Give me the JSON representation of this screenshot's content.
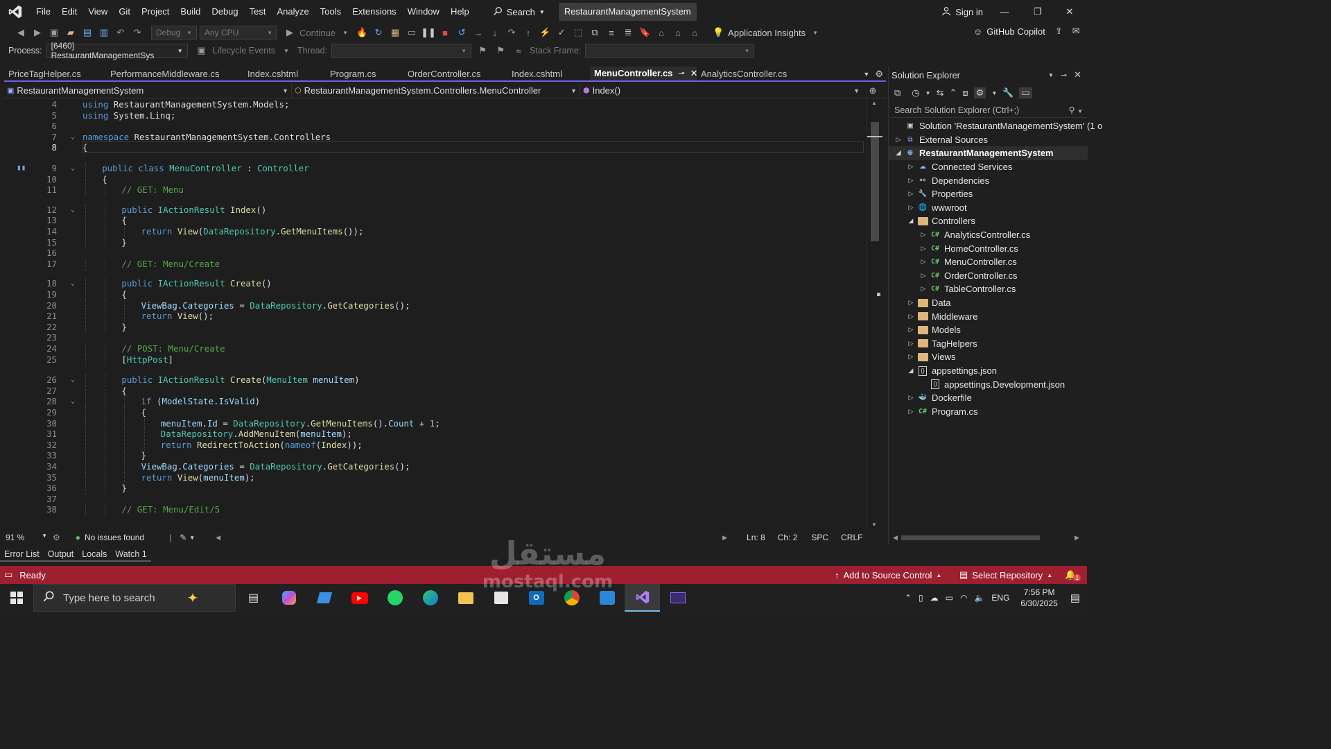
{
  "menu": {
    "items": [
      "File",
      "Edit",
      "View",
      "Git",
      "Project",
      "Build",
      "Debug",
      "Test",
      "Analyze",
      "Tools",
      "Extensions",
      "Window",
      "Help"
    ],
    "search_label": "Search",
    "solution_title": "RestaurantManagementSystem",
    "signin_label": "Sign in"
  },
  "toolbar": {
    "config": "Debug",
    "platform": "Any CPU",
    "continue_label": "Continue",
    "app_insights_label": "Application Insights",
    "copilot_label": "GitHub Copilot",
    "process_label": "Process:",
    "process_value": "[6460] RestaurantManagementSys",
    "lifecycle_label": "Lifecycle Events",
    "thread_label": "Thread:",
    "stack_frame_label": "Stack Frame:"
  },
  "tabs": [
    {
      "label": "PriceTagHelper.cs",
      "active": false
    },
    {
      "label": "PerformanceMiddleware.cs",
      "active": false
    },
    {
      "label": "Index.cshtml",
      "active": false
    },
    {
      "label": "Program.cs",
      "active": false
    },
    {
      "label": "OrderController.cs",
      "active": false
    },
    {
      "label": "Index.cshtml",
      "active": false
    },
    {
      "label": "MenuController.cs",
      "active": true
    },
    {
      "label": "AnalyticsController.cs",
      "active": false
    }
  ],
  "navbar": {
    "project": "RestaurantManagementSystem",
    "type": "RestaurantManagementSystem.Controllers.MenuController",
    "member": "Index()"
  },
  "editor": {
    "current_line": 8,
    "lines": [
      {
        "n": 4,
        "indent": 0,
        "tokens": [
          [
            "kw",
            "using"
          ],
          [
            "pl",
            " RestaurantManagementSystem.Models;"
          ]
        ]
      },
      {
        "n": 5,
        "indent": 0,
        "tokens": [
          [
            "kw",
            "using"
          ],
          [
            "pl",
            " System.Linq;"
          ]
        ]
      },
      {
        "n": 6,
        "indent": 0,
        "tokens": []
      },
      {
        "n": 7,
        "indent": 0,
        "fold": true,
        "tokens": [
          [
            "kw",
            "namespace"
          ],
          [
            "pl",
            " RestaurantManagementSystem.Controllers"
          ]
        ]
      },
      {
        "n": 8,
        "indent": 0,
        "tokens": [
          [
            "pl",
            "{"
          ]
        ]
      },
      {
        "n": 9,
        "indent": 1,
        "fold": true,
        "tokens": [
          [
            "kw",
            "public class "
          ],
          [
            "ty",
            "MenuController"
          ],
          [
            "pl",
            " : "
          ],
          [
            "ty",
            "Controller"
          ]
        ]
      },
      {
        "n": 10,
        "indent": 1,
        "tokens": [
          [
            "pl",
            "{"
          ]
        ]
      },
      {
        "n": 11,
        "indent": 2,
        "tokens": [
          [
            "cm",
            "// GET: Menu"
          ]
        ]
      },
      {
        "n": 12,
        "indent": 2,
        "fold": true,
        "tokens": [
          [
            "kw",
            "public "
          ],
          [
            "ty",
            "IActionResult"
          ],
          [
            "mt",
            " Index"
          ],
          [
            "pl",
            "()"
          ]
        ]
      },
      {
        "n": 13,
        "indent": 2,
        "tokens": [
          [
            "pl",
            "{"
          ]
        ]
      },
      {
        "n": 14,
        "indent": 3,
        "tokens": [
          [
            "kw",
            "return "
          ],
          [
            "mt",
            "View"
          ],
          [
            "pl",
            "("
          ],
          [
            "ty",
            "DataRepository"
          ],
          [
            "pl",
            "."
          ],
          [
            "mt",
            "GetMenuItems"
          ],
          [
            "pl",
            "());"
          ]
        ]
      },
      {
        "n": 15,
        "indent": 2,
        "tokens": [
          [
            "pl",
            "}"
          ]
        ]
      },
      {
        "n": 16,
        "indent": 0,
        "tokens": []
      },
      {
        "n": 17,
        "indent": 2,
        "tokens": [
          [
            "cm",
            "// GET: Menu/Create"
          ]
        ]
      },
      {
        "n": 18,
        "indent": 2,
        "fold": true,
        "tokens": [
          [
            "kw",
            "public "
          ],
          [
            "ty",
            "IActionResult"
          ],
          [
            "mt",
            " Create"
          ],
          [
            "pl",
            "()"
          ]
        ]
      },
      {
        "n": 19,
        "indent": 2,
        "tokens": [
          [
            "pl",
            "{"
          ]
        ]
      },
      {
        "n": 20,
        "indent": 3,
        "tokens": [
          [
            "vr",
            "ViewBag"
          ],
          [
            "pl",
            "."
          ],
          [
            "vr",
            "Categories"
          ],
          [
            "pl",
            " = "
          ],
          [
            "ty",
            "DataRepository"
          ],
          [
            "pl",
            "."
          ],
          [
            "mt",
            "GetCategories"
          ],
          [
            "pl",
            "();"
          ]
        ]
      },
      {
        "n": 21,
        "indent": 3,
        "tokens": [
          [
            "kw",
            "return "
          ],
          [
            "mt",
            "View"
          ],
          [
            "pl",
            "();"
          ]
        ]
      },
      {
        "n": 22,
        "indent": 2,
        "tokens": [
          [
            "pl",
            "}"
          ]
        ]
      },
      {
        "n": 23,
        "indent": 0,
        "tokens": []
      },
      {
        "n": 24,
        "indent": 2,
        "tokens": [
          [
            "cm",
            "// POST: Menu/Create"
          ]
        ]
      },
      {
        "n": 25,
        "indent": 2,
        "tokens": [
          [
            "pl",
            "["
          ],
          [
            "ty",
            "HttpPost"
          ],
          [
            "pl",
            "]"
          ]
        ]
      },
      {
        "n": 26,
        "indent": 2,
        "fold": true,
        "tokens": [
          [
            "kw",
            "public "
          ],
          [
            "ty",
            "IActionResult"
          ],
          [
            "mt",
            " Create"
          ],
          [
            "pl",
            "("
          ],
          [
            "ty",
            "MenuItem"
          ],
          [
            "vr",
            " menuItem"
          ],
          [
            "pl",
            ")"
          ]
        ]
      },
      {
        "n": 27,
        "indent": 2,
        "tokens": [
          [
            "pl",
            "{"
          ]
        ]
      },
      {
        "n": 28,
        "indent": 3,
        "fold": true,
        "tokens": [
          [
            "kw",
            "if "
          ],
          [
            "pl",
            "("
          ],
          [
            "vr",
            "ModelState"
          ],
          [
            "pl",
            "."
          ],
          [
            "vr",
            "IsValid"
          ],
          [
            "pl",
            ")"
          ]
        ]
      },
      {
        "n": 29,
        "indent": 3,
        "tokens": [
          [
            "pl",
            "{"
          ]
        ]
      },
      {
        "n": 30,
        "indent": 4,
        "tokens": [
          [
            "vr",
            "menuItem"
          ],
          [
            "pl",
            "."
          ],
          [
            "vr",
            "Id"
          ],
          [
            "pl",
            " = "
          ],
          [
            "ty",
            "DataRepository"
          ],
          [
            "pl",
            "."
          ],
          [
            "mt",
            "GetMenuItems"
          ],
          [
            "pl",
            "()."
          ],
          [
            "vr",
            "Count"
          ],
          [
            "pl",
            " + "
          ],
          [
            "nu",
            "1"
          ],
          [
            "pl",
            ";"
          ]
        ]
      },
      {
        "n": 31,
        "indent": 4,
        "tokens": [
          [
            "ty",
            "DataRepository"
          ],
          [
            "pl",
            "."
          ],
          [
            "mt",
            "AddMenuItem"
          ],
          [
            "pl",
            "("
          ],
          [
            "vr",
            "menuItem"
          ],
          [
            "pl",
            ");"
          ]
        ]
      },
      {
        "n": 32,
        "indent": 4,
        "tokens": [
          [
            "kw",
            "return "
          ],
          [
            "mt",
            "RedirectToAction"
          ],
          [
            "pl",
            "("
          ],
          [
            "kw",
            "nameof"
          ],
          [
            "pl",
            "("
          ],
          [
            "mt",
            "Index"
          ],
          [
            "pl",
            "));"
          ]
        ]
      },
      {
        "n": 33,
        "indent": 3,
        "tokens": [
          [
            "pl",
            "}"
          ]
        ]
      },
      {
        "n": 34,
        "indent": 3,
        "tokens": [
          [
            "vr",
            "ViewBag"
          ],
          [
            "pl",
            "."
          ],
          [
            "vr",
            "Categories"
          ],
          [
            "pl",
            " = "
          ],
          [
            "ty",
            "DataRepository"
          ],
          [
            "pl",
            "."
          ],
          [
            "mt",
            "GetCategories"
          ],
          [
            "pl",
            "();"
          ]
        ]
      },
      {
        "n": 35,
        "indent": 3,
        "tokens": [
          [
            "kw",
            "return "
          ],
          [
            "mt",
            "View"
          ],
          [
            "pl",
            "("
          ],
          [
            "vr",
            "menuItem"
          ],
          [
            "pl",
            ");"
          ]
        ]
      },
      {
        "n": 36,
        "indent": 2,
        "tokens": [
          [
            "pl",
            "}"
          ]
        ]
      },
      {
        "n": 37,
        "indent": 0,
        "tokens": []
      },
      {
        "n": 38,
        "indent": 2,
        "tokens": [
          [
            "cm",
            "// GET: Menu/Edit/5"
          ]
        ]
      }
    ]
  },
  "editor_status": {
    "zoom": "91 %",
    "issues": "No issues found",
    "line": "Ln: 8",
    "col": "Ch: 2",
    "whitespace": "SPC",
    "eol": "CRLF"
  },
  "tool_tabs": [
    "Error List",
    "Output",
    "Locals",
    "Watch 1"
  ],
  "solution_explorer": {
    "title": "Solution Explorer",
    "search_placeholder": "Search Solution Explorer (Ctrl+;)",
    "tree": [
      {
        "label": "Solution 'RestaurantManagementSystem' (1 o",
        "depth": 0,
        "arrow": "",
        "icon": "solution"
      },
      {
        "label": "External Sources",
        "depth": 0,
        "arrow": "collapsed",
        "icon": "external"
      },
      {
        "label": "RestaurantManagementSystem",
        "depth": 0,
        "arrow": "expanded",
        "icon": "project",
        "selected": true
      },
      {
        "label": "Connected Services",
        "depth": 1,
        "arrow": "collapsed",
        "icon": "connected"
      },
      {
        "label": "Dependencies",
        "depth": 1,
        "arrow": "collapsed",
        "icon": "deps"
      },
      {
        "label": "Properties",
        "depth": 1,
        "arrow": "collapsed",
        "icon": "props"
      },
      {
        "label": "wwwroot",
        "depth": 1,
        "arrow": "collapsed",
        "icon": "globe"
      },
      {
        "label": "Controllers",
        "depth": 1,
        "arrow": "expanded",
        "icon": "folder"
      },
      {
        "label": "AnalyticsController.cs",
        "depth": 2,
        "arrow": "collapsed",
        "icon": "cs"
      },
      {
        "label": "HomeController.cs",
        "depth": 2,
        "arrow": "collapsed",
        "icon": "cs"
      },
      {
        "label": "MenuController.cs",
        "depth": 2,
        "arrow": "collapsed",
        "icon": "cs"
      },
      {
        "label": "OrderController.cs",
        "depth": 2,
        "arrow": "collapsed",
        "icon": "cs"
      },
      {
        "label": "TableController.cs",
        "depth": 2,
        "arrow": "collapsed",
        "icon": "cs"
      },
      {
        "label": "Data",
        "depth": 1,
        "arrow": "collapsed",
        "icon": "folder"
      },
      {
        "label": "Middleware",
        "depth": 1,
        "arrow": "collapsed",
        "icon": "folder"
      },
      {
        "label": "Models",
        "depth": 1,
        "arrow": "collapsed",
        "icon": "folder"
      },
      {
        "label": "TagHelpers",
        "depth": 1,
        "arrow": "collapsed",
        "icon": "folder"
      },
      {
        "label": "Views",
        "depth": 1,
        "arrow": "collapsed",
        "icon": "folder"
      },
      {
        "label": "appsettings.json",
        "depth": 1,
        "arrow": "expanded",
        "icon": "json"
      },
      {
        "label": "appsettings.Development.json",
        "depth": 2,
        "arrow": "",
        "icon": "json"
      },
      {
        "label": "Dockerfile",
        "depth": 1,
        "arrow": "collapsed",
        "icon": "docker"
      },
      {
        "label": "Program.cs",
        "depth": 1,
        "arrow": "collapsed",
        "icon": "cs"
      }
    ]
  },
  "statusbar": {
    "ready": "Ready",
    "source_control": "Add to Source Control",
    "select_repo": "Select Repository",
    "notifications": "1"
  },
  "taskbar": {
    "search_placeholder": "Type here to search",
    "language": "ENG",
    "time": "7:56 PM",
    "date": "6/30/2025"
  },
  "watermark": {
    "arabic": "مستقل",
    "latin": "mostaql.com"
  },
  "colors": {
    "accent": "#7160e8",
    "status_bar": "#9e1f2f",
    "editor_bg": "#1e1e1e"
  }
}
